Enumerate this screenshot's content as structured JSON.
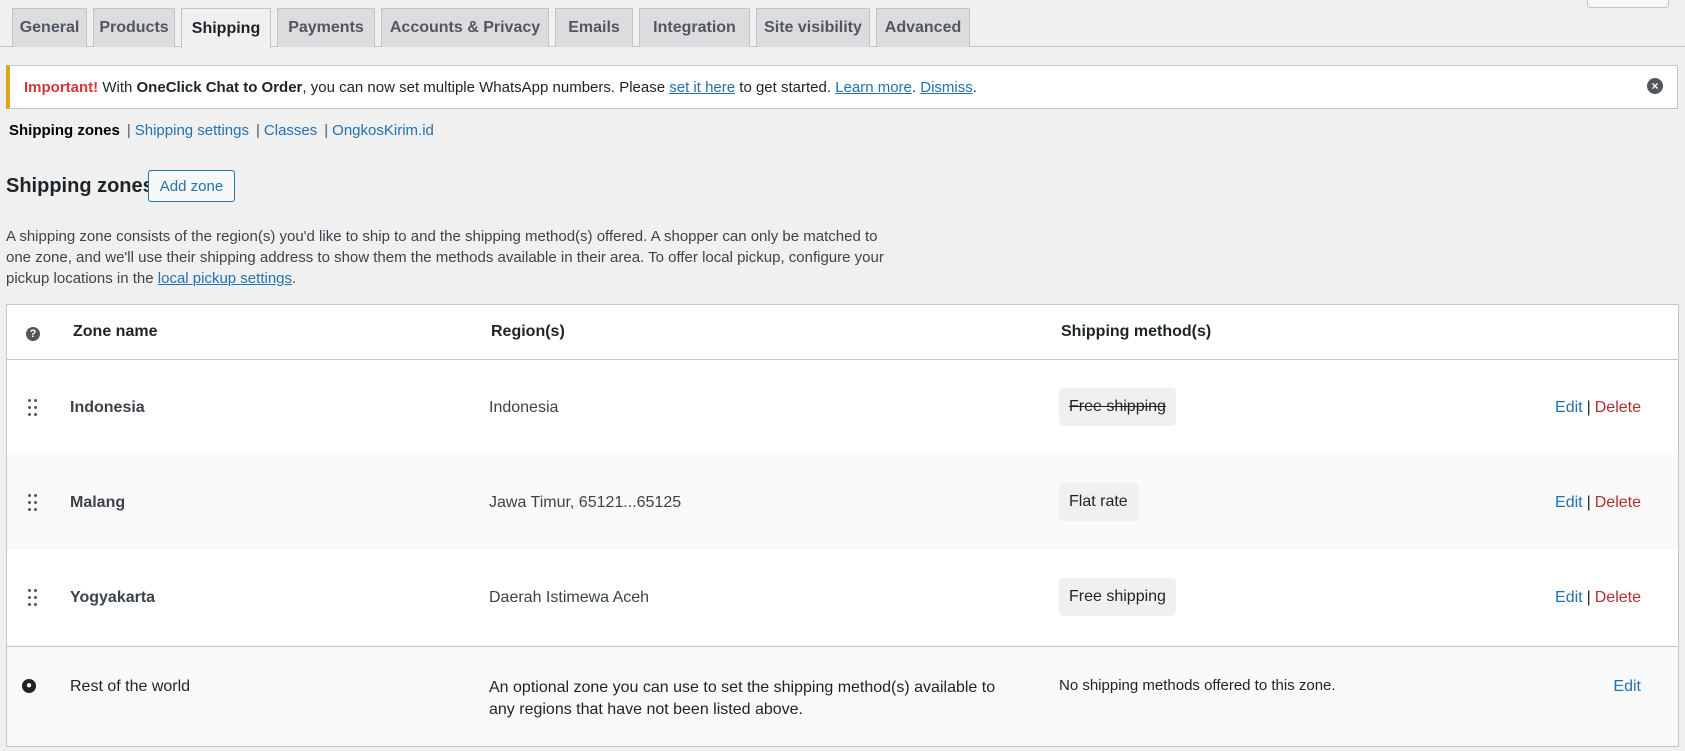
{
  "tabs": [
    {
      "label": "General"
    },
    {
      "label": "Products"
    },
    {
      "label": "Shipping"
    },
    {
      "label": "Payments"
    },
    {
      "label": "Accounts & Privacy"
    },
    {
      "label": "Emails"
    },
    {
      "label": "Integration"
    },
    {
      "label": "Site visibility"
    },
    {
      "label": "Advanced"
    }
  ],
  "notice": {
    "important": "Important!",
    "text1": " With ",
    "plugin": "OneClick Chat to Order",
    "text2": ", you can now set multiple WhatsApp numbers. Please ",
    "link1": "set it here",
    "text3": " to get started. ",
    "link2": "Learn more",
    "text4": ". ",
    "link3": "Dismiss",
    "text5": ".",
    "close_icon": "close-icon"
  },
  "subnav": {
    "current": "Shipping zones",
    "sep": "|",
    "links": [
      "Shipping settings",
      "Classes",
      "OngkosKirim.id"
    ]
  },
  "heading": {
    "title": "Shipping zones",
    "add_zone": "Add zone"
  },
  "description": {
    "text": "A shipping zone consists of the region(s) you'd like to ship to and the shipping method(s) offered. A shopper can only be matched to one zone, and we'll use their shipping address to show them the methods available in their area. To offer local pickup, configure your pickup locations in the ",
    "link": "local pickup settings",
    "end": "."
  },
  "table": {
    "headers": {
      "zone": "Zone name",
      "region": "Region(s)",
      "method": "Shipping method(s)"
    },
    "rows": [
      {
        "zone": "Indonesia",
        "region": "Indonesia",
        "method": "Free shipping",
        "method_enabled": false
      },
      {
        "zone": "Malang",
        "region": "Jawa Timur, 65121...65125",
        "method": "Flat rate",
        "method_enabled": true
      },
      {
        "zone": "Yogyakarta",
        "region": "Daerah Istimewa Aceh",
        "method": "Free shipping",
        "method_enabled": true
      }
    ],
    "actions": {
      "edit": "Edit",
      "sep": "|",
      "delete": "Delete"
    },
    "rest": {
      "name": "Rest of the world",
      "description": "An optional zone you can use to set the shipping method(s) available to any regions that have not been listed above.",
      "method": "No shipping methods offered to this zone.",
      "edit": "Edit"
    }
  },
  "colors": {
    "accent": "#2271b1",
    "danger": "#b32d2e",
    "notice_border": "#dba617",
    "important": "#d63638"
  }
}
